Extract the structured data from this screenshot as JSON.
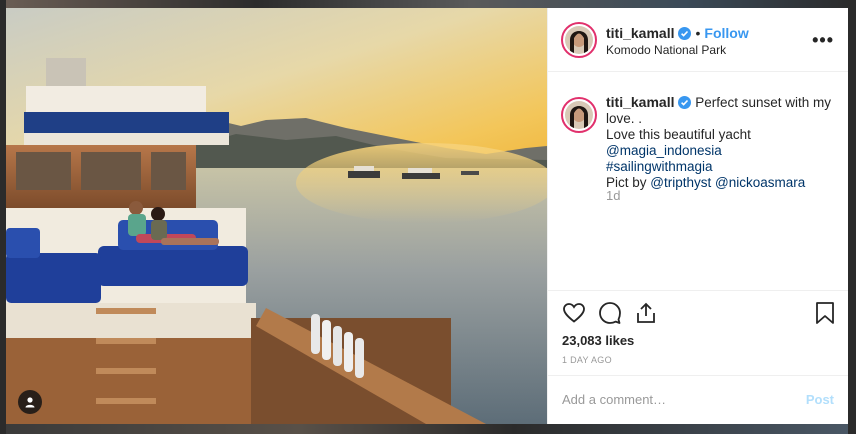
{
  "post": {
    "username": "titi_kamall",
    "follow_label": "Follow",
    "separator": "•",
    "location": "Komodo National Park",
    "more_label": "•••",
    "caption": {
      "line1": "Perfect sunset with my love. .",
      "line2": "Love this beautiful yacht",
      "mention1": "@magia_indonesia",
      "hashtag1": "#sailingwithmagia",
      "pict_by": "Pict by",
      "mention2": "@tripthyst",
      "mention3": "@nickoasmara"
    },
    "time_ago": "1d",
    "likes": "23,083 likes",
    "timestamp": "1 DAY AGO"
  },
  "comment": {
    "placeholder": "Add a comment…",
    "post_label": "Post"
  },
  "icons": {
    "verified": "verified-badge-icon",
    "like": "heart-icon",
    "comment": "comment-bubble-icon",
    "share": "share-icon",
    "save": "bookmark-icon",
    "tagged": "user-tag-icon"
  },
  "colors": {
    "accent": "#3897f0",
    "verified": "#3897f0",
    "mention": "#003569",
    "muted": "#999999",
    "post_disabled": "#b2dffc"
  }
}
